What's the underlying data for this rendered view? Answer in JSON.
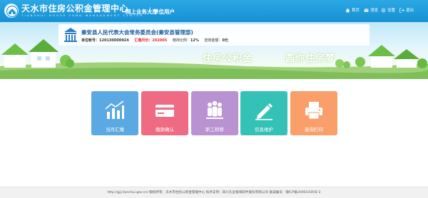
{
  "header": {
    "title": "天水市住房公积金管理中心",
    "subtitle": "TIANSHUI HOUSE FUND MANAGEMENT CENTER",
    "nav_hall": "网上业务大厅",
    "nav_user": "单位用户",
    "links": {
      "home": "首页",
      "messages": "消息",
      "settings": "设置",
      "exit": "退出"
    },
    "bg_color": "#1f9bdc"
  },
  "account": {
    "org_name": "秦安县人民代表大会常务委员会(秦安县管理部)",
    "account_label": "单位帐号：",
    "account_number": "120130000924",
    "paid_label": "汇缴月份：",
    "paid_month": "202005",
    "ratio_label": "缴存比例：",
    "ratio_value": "12%",
    "balance_label": "挂账金额：",
    "balance_value": "0元"
  },
  "banner": {
    "slogan_1": "住房公积金",
    "slogan_2": "圆你住房梦"
  },
  "tiles": [
    {
      "label": "当月汇缴",
      "icon": "bar-chart-icon",
      "color": "#5ba9e2"
    },
    {
      "label": "缴款确认",
      "icon": "payment-card-icon",
      "color": "#ef6a83"
    },
    {
      "label": "职工转移",
      "icon": "staff-transfer-icon",
      "color": "#b892d1"
    },
    {
      "label": "信息维护",
      "icon": "edit-pencil-icon",
      "color": "#35c2b6"
    },
    {
      "label": "查询打印",
      "icon": "printer-icon",
      "color": "#fb9f6a"
    }
  ],
  "footer": {
    "text": "http://gjj.tianshui.gov.cn/ 版权所有：天水市住房公积金管理中心 技术支持：四川久远银海软件股份有限公司    备案编号：陇ICP备20001436号-2"
  }
}
